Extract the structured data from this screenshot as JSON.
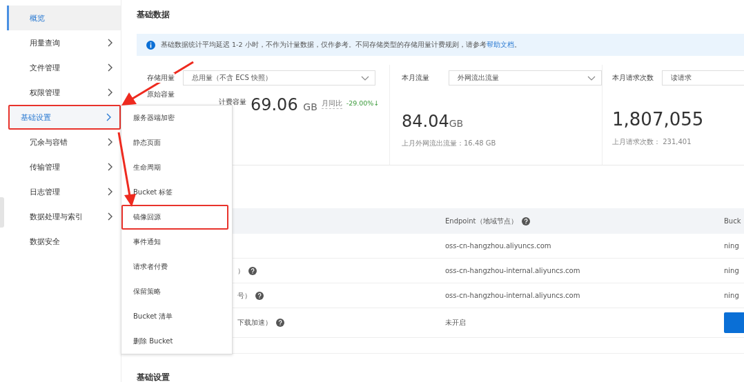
{
  "sidebar": {
    "items": [
      {
        "label": "概览",
        "kind": "link",
        "selected": true,
        "expanded": false
      },
      {
        "label": "用量查询",
        "kind": "group",
        "selected": false,
        "expanded": false
      },
      {
        "label": "文件管理",
        "kind": "group",
        "selected": false,
        "expanded": false
      },
      {
        "label": "权限管理",
        "kind": "group",
        "selected": false,
        "expanded": false
      },
      {
        "label": "基础设置",
        "kind": "group",
        "selected": false,
        "expanded": true,
        "highlighted": true
      },
      {
        "label": "冗余与容错",
        "kind": "group",
        "selected": false,
        "expanded": false
      },
      {
        "label": "传输管理",
        "kind": "group",
        "selected": false,
        "expanded": false
      },
      {
        "label": "日志管理",
        "kind": "group",
        "selected": false,
        "expanded": false
      },
      {
        "label": "数据处理与索引",
        "kind": "group",
        "selected": false,
        "expanded": false
      },
      {
        "label": "数据安全",
        "kind": "link",
        "selected": false,
        "expanded": false
      }
    ]
  },
  "submenu": {
    "items": [
      {
        "label": "服务器端加密",
        "highlighted": false
      },
      {
        "label": "静态页面",
        "highlighted": false
      },
      {
        "label": "生命周期",
        "highlighted": false
      },
      {
        "label": "Bucket 标签",
        "highlighted": false
      },
      {
        "label": "镜像回源",
        "highlighted": true
      },
      {
        "label": "事件通知",
        "highlighted": false
      },
      {
        "label": "请求者付费",
        "highlighted": false
      },
      {
        "label": "保留策略",
        "highlighted": false
      },
      {
        "label": "Bucket 清单",
        "highlighted": false
      },
      {
        "label": "删除 Bucket",
        "highlighted": false
      }
    ]
  },
  "title": "基础数据",
  "info": {
    "text": "基础数据统计平均延迟 1-2 小时，不作为计量数据，仅作参考。不同存储类型的存储用量计费规则，请参考",
    "link": "帮助文档",
    "suffix": "。"
  },
  "stats": [
    {
      "label": "存储用量",
      "select": "总用量（不含 ECS 快照）",
      "sub_label_1": "原始容量",
      "sub_label_2": "计费容量",
      "value": "69.06",
      "unit": "GB",
      "compare_label": "月同比",
      "compare": "-29.00%↓"
    },
    {
      "label": "本月流量",
      "select": "外网流出流量",
      "value": "84.04",
      "unit": "GB",
      "note": "上月外网流出流量：16.48 GB"
    },
    {
      "label": "本月请求次数",
      "select": "读请求",
      "value": "1,807,055",
      "note": "上月请求次数： 231,401"
    }
  ],
  "table": {
    "columns": [
      "Endpoint（地域节点）",
      "Buck"
    ],
    "rows": [
      {
        "help": false,
        "endpoint": "oss-cn-hangzhou.aliyuncs.com",
        "kind": "text",
        "column_3": "ning"
      },
      {
        "label": "）",
        "help": true,
        "endpoint": "oss-cn-hangzhou-internal.aliyuncs.com",
        "kind": "text",
        "column_3": "ning"
      },
      {
        "label": "号）",
        "help": true,
        "endpoint": "oss-cn-hangzhou-internal.aliyuncs.com",
        "kind": "text",
        "column_3": "ning"
      },
      {
        "label": "下载加速）",
        "help": true,
        "endpoint": "未开启",
        "kind": "button"
      }
    ]
  },
  "section_title": "基础设置"
}
